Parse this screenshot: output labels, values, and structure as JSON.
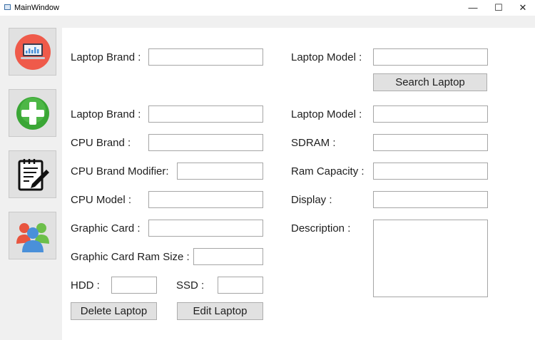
{
  "window": {
    "title": "MainWindow",
    "minimize_glyph": "—",
    "maximize_glyph": "☐",
    "close_glyph": "✕"
  },
  "sidebar": {
    "items": [
      {
        "name": "laptop-dashboard",
        "icon": "laptop-chart-icon"
      },
      {
        "name": "add",
        "icon": "plus-icon"
      },
      {
        "name": "edit",
        "icon": "notepad-pencil-icon"
      },
      {
        "name": "users",
        "icon": "users-group-icon"
      }
    ]
  },
  "search": {
    "brand_label": "Laptop Brand :",
    "brand_value": "",
    "model_label": "Laptop Model :",
    "model_value": "",
    "button_label": "Search Laptop"
  },
  "form": {
    "laptop_brand_label": "Laptop Brand :",
    "laptop_model_label": "Laptop Model :",
    "cpu_brand_label": "CPU Brand :",
    "sdram_label": "SDRAM :",
    "cpu_brand_modifier_label": "CPU Brand Modifier:",
    "ram_capacity_label": "Ram Capacity :",
    "cpu_model_label": "CPU Model :",
    "display_label": "Display :",
    "graphic_card_label": "Graphic Card :",
    "description_label": "Description :",
    "graphic_card_ram_label": "Graphic Card Ram Size :",
    "hdd_label": "HDD :",
    "ssd_label": "SSD :",
    "delete_button": "Delete Laptop",
    "edit_button": "Edit Laptop"
  },
  "colors": {
    "laptop_icon_bg": "#ef5a4a",
    "plus_icon": "#3aa635",
    "users_red": "#e8553f",
    "users_green": "#6cbf4a",
    "users_blue": "#4a90d9"
  }
}
